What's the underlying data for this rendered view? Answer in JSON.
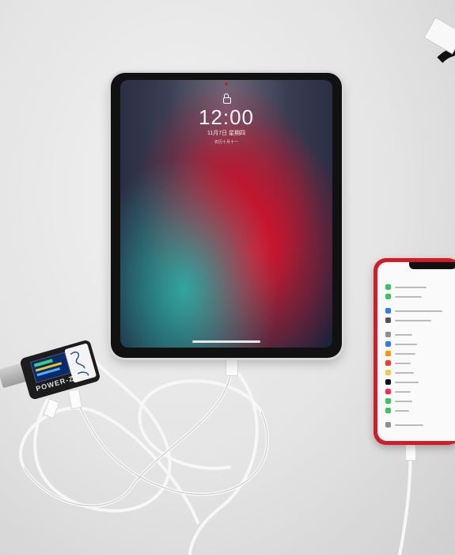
{
  "ipad": {
    "time": "12:00",
    "date_line": "11月7日 星期四",
    "sub_line": "农历十月十一"
  },
  "usb_tester": {
    "brand": "POWER-Z"
  },
  "colors": {
    "iphone_body": "#d31c28",
    "ipad_bezel": "#111111",
    "cable": "#f7f7f7",
    "table": "#e4e4e4"
  }
}
